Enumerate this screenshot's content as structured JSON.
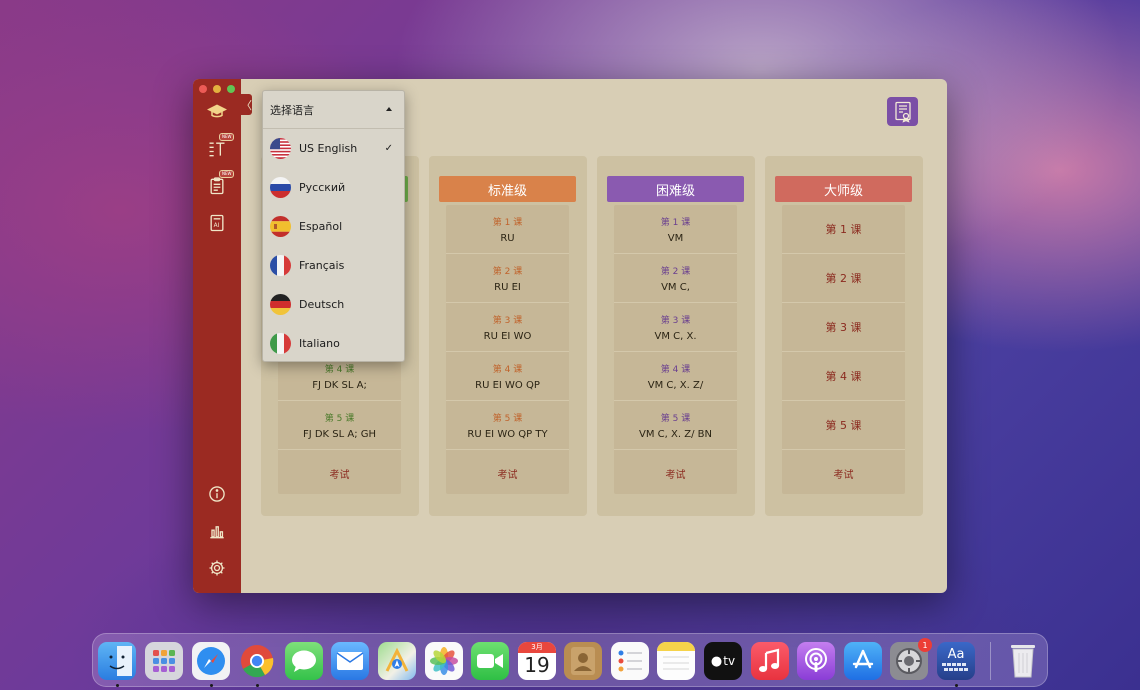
{
  "dropdown": {
    "title": "选择语言",
    "languages": [
      {
        "label": "US English",
        "selected": true
      },
      {
        "label": "Русский"
      },
      {
        "label": "Español"
      },
      {
        "label": "Français"
      },
      {
        "label": "Deutsch"
      },
      {
        "label": "Italiano"
      }
    ],
    "check_mark": "✓"
  },
  "columns": [
    {
      "title": "",
      "header_color": "#6fae4a",
      "lessons": [
        {
          "num": "第 4 课",
          "keys": "FJ DK SL A;"
        },
        {
          "num": "第 5 课",
          "keys": "FJ DK SL A; GH"
        }
      ],
      "exam": "考试"
    },
    {
      "title": "标准级",
      "header_color": "#d9824a",
      "lessons": [
        {
          "num": "第 1 课",
          "keys": "RU"
        },
        {
          "num": "第 2 课",
          "keys": "RU EI"
        },
        {
          "num": "第 3 课",
          "keys": "RU EI WO"
        },
        {
          "num": "第 4 课",
          "keys": "RU EI WO QP"
        },
        {
          "num": "第 5 课",
          "keys": "RU EI WO QP TY"
        }
      ],
      "exam": "考试"
    },
    {
      "title": "困难级",
      "header_color": "#8a5ab0",
      "lessons": [
        {
          "num": "第 1 课",
          "keys": "VM"
        },
        {
          "num": "第 2 课",
          "keys": "VM C,"
        },
        {
          "num": "第 3 课",
          "keys": "VM C, X."
        },
        {
          "num": "第 4 课",
          "keys": "VM C, X. Z/"
        },
        {
          "num": "第 5 课",
          "keys": "VM C, X. Z/ BN"
        }
      ],
      "exam": "考试"
    },
    {
      "title": "大师级",
      "header_color": "#d06a5e",
      "lessons": [
        {
          "num": "第 1 课"
        },
        {
          "num": "第 2 课"
        },
        {
          "num": "第 3 课"
        },
        {
          "num": "第 4 课"
        },
        {
          "num": "第 5 课"
        }
      ],
      "exam": "考试"
    }
  ],
  "sidebar": {
    "new_badge": "NEW",
    "icons": [
      "graduation-cap-icon",
      "text-size-icon",
      "clipboard-icon",
      "ai-document-icon",
      "info-icon",
      "bar-chart-icon",
      "gear-icon"
    ]
  },
  "collapse_glyph": "〈",
  "dock": {
    "calendar_month": "3月",
    "calendar_day": "19",
    "tv_label": "tv",
    "dictionary_label": "Aa",
    "settings_badge": "1"
  },
  "colors": {
    "sidebar": "#9b2a22",
    "content_bg": "#d8ceb5",
    "lesson_num_standard": "#c0632c",
    "lesson_num_hard": "#6a3f8f",
    "lesson_num_master": "#8b2a1f",
    "lesson_num_easy": "#4b7a2a"
  }
}
